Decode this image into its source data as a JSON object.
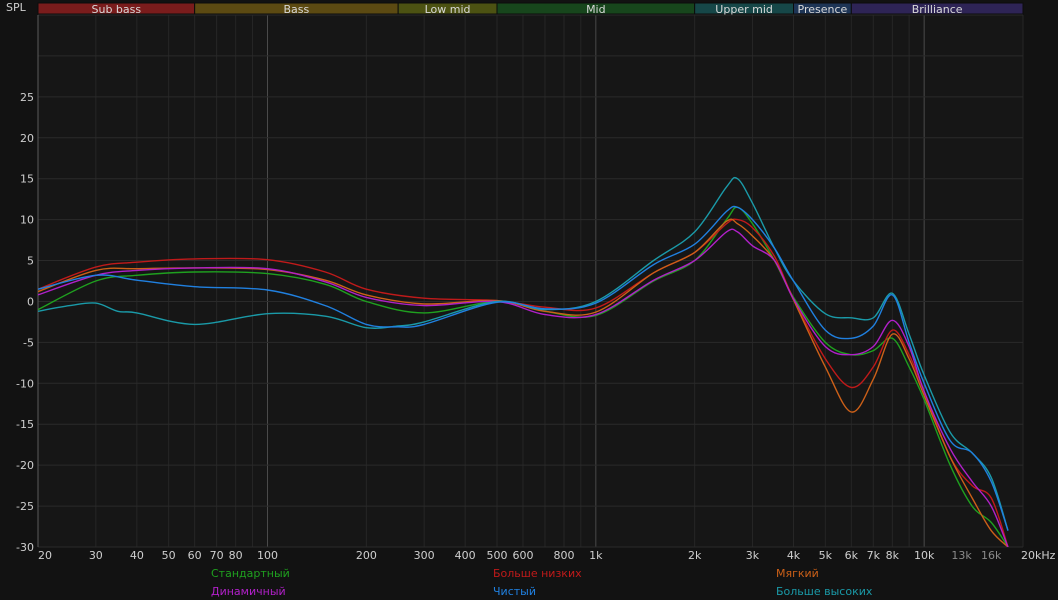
{
  "chart_data": {
    "type": "line",
    "ylabel": "SPL",
    "xunit": "20kHz",
    "ylim": [
      -30,
      30
    ],
    "xlim": [
      20,
      20000
    ],
    "xscale": "log",
    "grid": true,
    "bands": [
      {
        "name": "Sub bass",
        "from": 20,
        "to": 60,
        "color": "#7a1c1c"
      },
      {
        "name": "Bass",
        "from": 60,
        "to": 250,
        "color": "#5c4a12"
      },
      {
        "name": "Low mid",
        "from": 250,
        "to": 500,
        "color": "#4c5212"
      },
      {
        "name": "Mid",
        "from": 500,
        "to": 2000,
        "color": "#17461c"
      },
      {
        "name": "Upper mid",
        "from": 2000,
        "to": 4000,
        "color": "#164748"
      },
      {
        "name": "Presence",
        "from": 4000,
        "to": 6000,
        "color": "#1e3556"
      },
      {
        "name": "Brilliance",
        "from": 6000,
        "to": 20000,
        "color": "#2e2456"
      }
    ],
    "xticks": [
      {
        "v": 20,
        "label": "20"
      },
      {
        "v": 30,
        "label": "30"
      },
      {
        "v": 40,
        "label": "40"
      },
      {
        "v": 50,
        "label": "50"
      },
      {
        "v": 60,
        "label": "60"
      },
      {
        "v": 70,
        "label": "70"
      },
      {
        "v": 80,
        "label": "80"
      },
      {
        "v": 100,
        "label": "100"
      },
      {
        "v": 200,
        "label": "200"
      },
      {
        "v": 300,
        "label": "300"
      },
      {
        "v": 400,
        "label": "400"
      },
      {
        "v": 500,
        "label": "500"
      },
      {
        "v": 600,
        "label": "600"
      },
      {
        "v": 800,
        "label": "800"
      },
      {
        "v": 1000,
        "label": "1k"
      },
      {
        "v": 2000,
        "label": "2k"
      },
      {
        "v": 3000,
        "label": "3k"
      },
      {
        "v": 4000,
        "label": "4k"
      },
      {
        "v": 5000,
        "label": "5k"
      },
      {
        "v": 6000,
        "label": "6k"
      },
      {
        "v": 7000,
        "label": "7k"
      },
      {
        "v": 8000,
        "label": "8k"
      },
      {
        "v": 10000,
        "label": "10k"
      },
      {
        "v": 13000,
        "label": "13k",
        "dim": true
      },
      {
        "v": 16000,
        "label": "16k",
        "dim": true
      }
    ],
    "yticks": [
      25,
      20,
      15,
      10,
      5,
      0,
      -5,
      -10,
      -15,
      -20,
      -25,
      -30
    ],
    "series": [
      {
        "name": "Стандартный",
        "color": "#1fa01f",
        "x": [
          20,
          30,
          40,
          60,
          100,
          150,
          200,
          300,
          500,
          700,
          1000,
          1500,
          2000,
          2500,
          2700,
          3000,
          3500,
          4000,
          5000,
          6000,
          7000,
          8000,
          9000,
          10000,
          12000,
          14000,
          16000,
          18000
        ],
        "y": [
          -1,
          2.5,
          3.2,
          3.6,
          3.4,
          2.1,
          0,
          -1.4,
          0,
          -1.2,
          -1.7,
          2.5,
          5,
          10,
          11.5,
          9.5,
          5,
          0.5,
          -5,
          -6.5,
          -6,
          -4.5,
          -8,
          -12,
          -20,
          -25,
          -27,
          -30
        ]
      },
      {
        "name": "Больше низких",
        "color": "#c01a1a",
        "x": [
          20,
          30,
          40,
          60,
          100,
          150,
          200,
          300,
          500,
          700,
          1000,
          1500,
          2000,
          2500,
          2700,
          3000,
          3500,
          4000,
          5000,
          6000,
          7000,
          8000,
          9000,
          10000,
          12000,
          14000,
          16000,
          18000
        ],
        "y": [
          1.5,
          4.2,
          4.8,
          5.2,
          5.1,
          3.6,
          1.5,
          0.4,
          0.1,
          -0.7,
          -0.8,
          3.5,
          6,
          9.5,
          10,
          9,
          5.5,
          0.3,
          -7,
          -10.5,
          -8,
          -3.5,
          -6.5,
          -11,
          -19,
          -22.5,
          -24,
          -30
        ]
      },
      {
        "name": "Мягкий",
        "color": "#cc6018",
        "x": [
          20,
          30,
          40,
          60,
          100,
          150,
          200,
          300,
          500,
          700,
          1000,
          1500,
          2000,
          2500,
          2700,
          3000,
          3500,
          4000,
          5000,
          6000,
          7000,
          8000,
          9000,
          10000,
          12000,
          14000,
          16000,
          18000
        ],
        "y": [
          1.2,
          3.8,
          4,
          4.1,
          3.9,
          2.6,
          0.8,
          -0.3,
          0.1,
          -1.2,
          -1.3,
          3.5,
          6,
          9.8,
          9.5,
          8,
          5,
          0.2,
          -8,
          -13.5,
          -9.5,
          -4,
          -7,
          -11.5,
          -19,
          -24,
          -28,
          -30
        ]
      },
      {
        "name": "Динамичный",
        "color": "#b020c8",
        "x": [
          20,
          30,
          40,
          60,
          100,
          150,
          200,
          300,
          500,
          700,
          1000,
          1500,
          2000,
          2500,
          2700,
          3000,
          3500,
          4000,
          5000,
          6000,
          7000,
          8000,
          9000,
          10000,
          12000,
          14000,
          16000,
          18000
        ],
        "y": [
          0.8,
          3.2,
          3.8,
          4.1,
          4,
          2.4,
          0.5,
          -0.5,
          0,
          -1.6,
          -1.6,
          2.6,
          5,
          8.5,
          8.5,
          6.8,
          5,
          0.3,
          -5.5,
          -6.5,
          -5.5,
          -2.3,
          -5.5,
          -11,
          -18,
          -22,
          -25,
          -30
        ]
      },
      {
        "name": "Чистый",
        "color": "#2080e0",
        "x": [
          20,
          30,
          40,
          60,
          100,
          150,
          200,
          250,
          300,
          500,
          700,
          1000,
          1500,
          2000,
          2500,
          2700,
          3000,
          3500,
          4000,
          5000,
          6000,
          7000,
          8000,
          9000,
          10000,
          12000,
          14000,
          16000,
          18000
        ],
        "y": [
          1.5,
          3.2,
          2.6,
          1.8,
          1.4,
          -0.5,
          -2.8,
          -3.1,
          -2.8,
          -0.1,
          -0.9,
          -0.2,
          4.5,
          7,
          11,
          11.5,
          10,
          6.5,
          2.5,
          -3.5,
          -4.5,
          -3,
          0.8,
          -5,
          -10,
          -17,
          -18.5,
          -22,
          -28
        ]
      },
      {
        "name": "Больше высоких",
        "color": "#1a9aa8",
        "x": [
          20,
          25,
          30,
          35,
          40,
          60,
          100,
          150,
          200,
          250,
          300,
          500,
          700,
          1000,
          1500,
          2000,
          2500,
          2700,
          3000,
          3500,
          4000,
          5000,
          6000,
          7000,
          8000,
          9000,
          10000,
          12000,
          14000,
          16000,
          18000
        ],
        "y": [
          -1.2,
          -0.5,
          -0.2,
          -1.2,
          -1.4,
          -2.8,
          -1.5,
          -1.8,
          -3.2,
          -3,
          -2.5,
          0,
          -1,
          0,
          5,
          8.5,
          14,
          15,
          12,
          6.5,
          2.5,
          -1.5,
          -2,
          -2,
          1,
          -4,
          -9,
          -16,
          -18.5,
          -21.5,
          -28
        ]
      }
    ]
  }
}
